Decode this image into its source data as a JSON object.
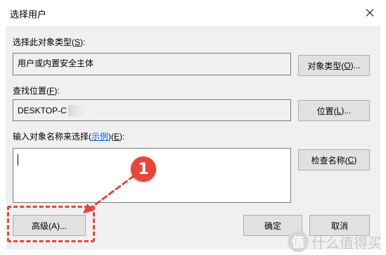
{
  "window": {
    "title": "选择用户",
    "close_icon": "close-icon"
  },
  "object_type": {
    "label_text": "选择此对象类型(",
    "label_key": "S",
    "label_tail": "):",
    "value": "用户或内置安全主体",
    "button_text": "对象类型(",
    "button_key": "O",
    "button_tail": ")..."
  },
  "location": {
    "label_text": "查找位置(",
    "label_key": "F",
    "label_tail": "):",
    "value": "DESKTOP-C",
    "button_text": "位置(",
    "button_key": "L",
    "button_tail": ")..."
  },
  "names": {
    "label_text": "输入对象名称来选择(",
    "label_link": "示例",
    "label_mid": ")(",
    "label_key": "E",
    "label_tail": "):",
    "input_value": "",
    "check_button_text": "检查名称(",
    "check_button_key": "C",
    "check_button_tail": ")"
  },
  "footer": {
    "advanced_button": "高级(A)...",
    "ok_button": "确定",
    "cancel_button": "取消"
  },
  "annotation": {
    "callout_number": "1",
    "accent_color": "#e8453a"
  },
  "watermark": {
    "logo_glyph": "值",
    "text": "什么值得买"
  },
  "colors": {
    "dialog_bg": "#f0f0f0",
    "button_bg": "#e1e1e1",
    "link": "#0066cc"
  }
}
